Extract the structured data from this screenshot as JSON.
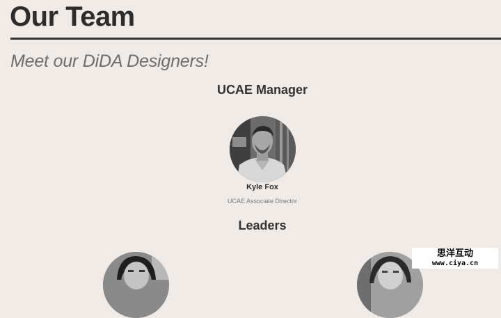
{
  "page": {
    "title": "Our Team",
    "tagline": "Meet our DiDA Designers!"
  },
  "sections": {
    "manager": {
      "heading": "UCAE Manager",
      "member": {
        "name": "Kyle Fox",
        "role": "UCAE Associate Director"
      }
    },
    "leaders": {
      "heading": "Leaders"
    }
  },
  "watermark": {
    "name": "思洋互动",
    "url": "www.ciya.cn"
  },
  "colors": {
    "background": "#f1ebe8",
    "text": "#333232",
    "tagline": "#6f6d6b"
  }
}
